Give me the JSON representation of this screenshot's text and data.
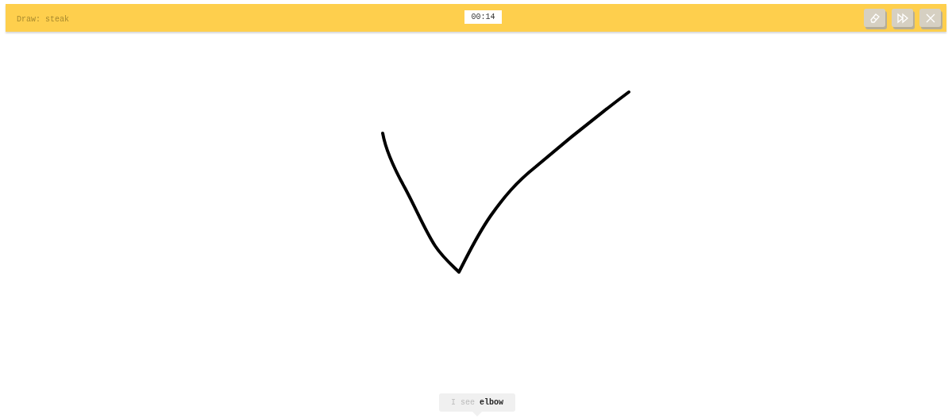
{
  "header": {
    "prompt": "Draw: steak",
    "timer": "00:14",
    "buttons": [
      {
        "kind": "erase"
      },
      {
        "kind": "skip"
      },
      {
        "kind": "close"
      }
    ]
  },
  "guess": {
    "text": "I see **elbow**"
  }
}
